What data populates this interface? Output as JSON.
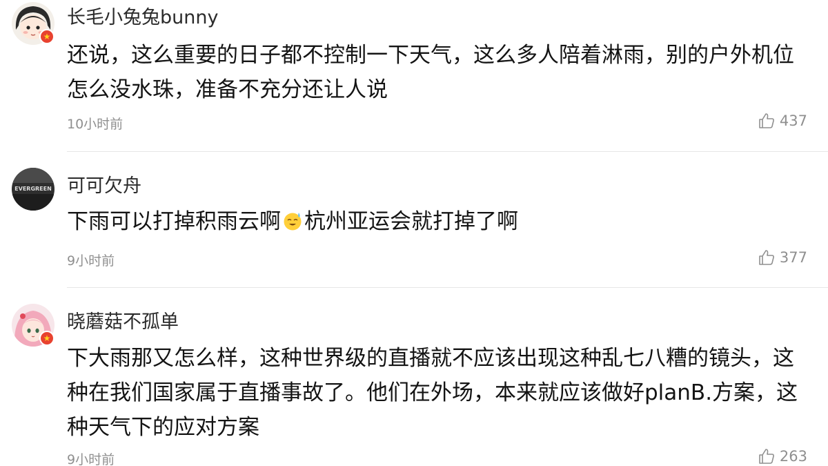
{
  "comments": [
    {
      "username": "长毛小兔兔bunny",
      "text": "还说，这么重要的日子都不控制一下天气，这么多人陪着淋雨，别的户外机位怎么没水珠，准备不充分还让人说",
      "time": "10小时前",
      "likes": "437",
      "avatar_icon": "cartoon-girl-avatar",
      "has_badge": true
    },
    {
      "username": "可可欠舟",
      "text_before_emoji": "下雨可以打掉积雨云啊",
      "emoji": "sweat-smile-emoji",
      "text_after_emoji": "杭州亚运会就打掉了啊",
      "time": "9小时前",
      "likes": "377",
      "avatar_icon": "dark-text-avatar",
      "avatar_text": "EVERGREEN",
      "has_badge": false
    },
    {
      "username": "晓蘑菇不孤单",
      "text": "下大雨那又怎么样，这种世界级的直播就不应该出现这种乱七八糟的镜头，这种在我们国家属于直播事故了。他们在外场，本来就应该做好planB.方案，这种天气下的应对方案",
      "time": "9小时前",
      "likes": "263",
      "avatar_icon": "pink-hair-girl-avatar",
      "has_badge": true
    }
  ],
  "colors": {
    "text": "#141414",
    "username": "#2b2b2b",
    "meta": "#8f8f8f",
    "divider": "#e6e6e6",
    "badge": "#e8422f"
  }
}
